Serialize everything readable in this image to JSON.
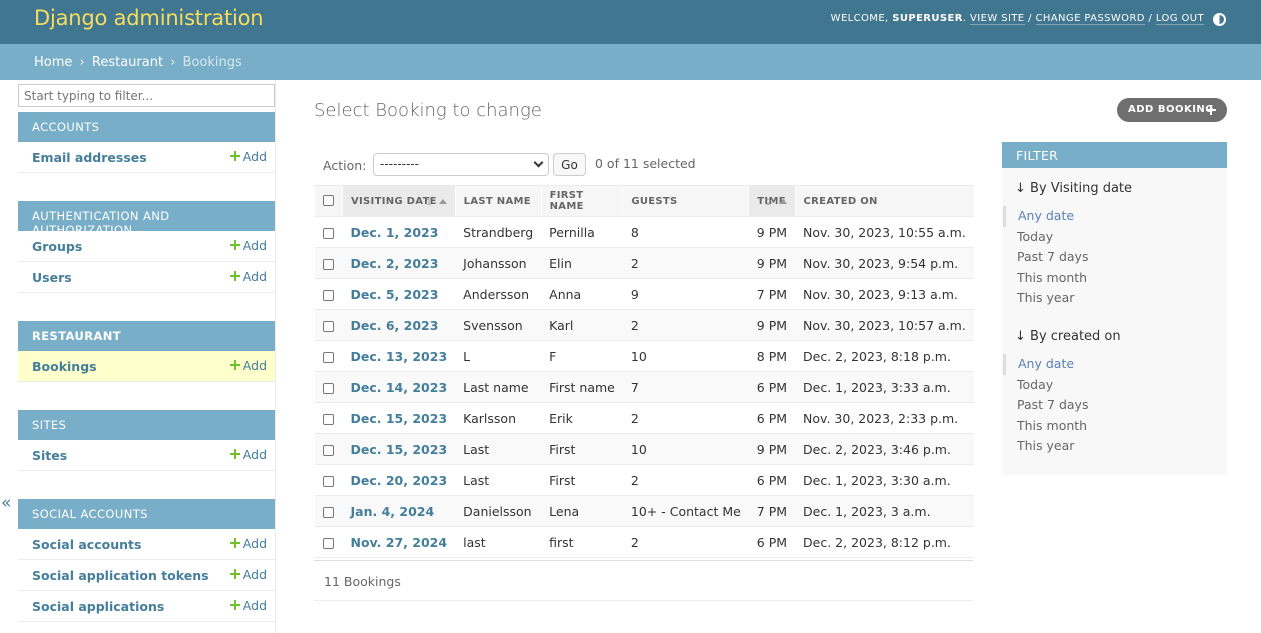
{
  "header": {
    "brand": "Django administration",
    "welcome": "WELCOME,",
    "username": "SUPERUSER",
    "view_site": "VIEW SITE",
    "change_password": "CHANGE PASSWORD",
    "log_out": "LOG OUT",
    "separator": "/"
  },
  "breadcrumbs": {
    "home": "Home",
    "app": "Restaurant",
    "current": "Bookings",
    "sep": "›"
  },
  "sidebar": {
    "filter_placeholder": "Start typing to filter...",
    "add_label": "Add",
    "collapse_glyph": "«",
    "modules": [
      {
        "caption": "Accounts",
        "rows": [
          {
            "label": "Email addresses"
          }
        ]
      },
      {
        "caption": "Authentication and Authorization",
        "rows": [
          {
            "label": "Groups"
          },
          {
            "label": "Users"
          }
        ]
      },
      {
        "caption": "Restaurant",
        "rows": [
          {
            "label": "Bookings"
          }
        ]
      },
      {
        "caption": "Sites",
        "rows": [
          {
            "label": "Sites"
          }
        ]
      },
      {
        "caption": "Social accounts",
        "rows": [
          {
            "label": "Social accounts"
          },
          {
            "label": "Social application tokens"
          },
          {
            "label": "Social applications"
          }
        ]
      }
    ]
  },
  "content": {
    "title": "Select Booking to change",
    "add_button": "ADD BOOKING",
    "action_label": "Action:",
    "action_value": "---------",
    "go_label": "Go",
    "selected_text": "0 of 11 selected",
    "paginator": "11 Bookings"
  },
  "table": {
    "columns": [
      "Visiting date",
      "Last name",
      "First name",
      "Guests",
      "Time",
      "Created on"
    ],
    "sort_numbers": {
      "visiting_date": "1",
      "time": "2"
    },
    "rows": [
      {
        "date": "Dec. 1, 2023",
        "last": "Strandberg",
        "first": "Pernilla",
        "guests": "8",
        "time": "9 PM",
        "created": "Nov. 30, 2023, 10:55 a.m."
      },
      {
        "date": "Dec. 2, 2023",
        "last": "Johansson",
        "first": "Elin",
        "guests": "2",
        "time": "9 PM",
        "created": "Nov. 30, 2023, 9:54 p.m."
      },
      {
        "date": "Dec. 5, 2023",
        "last": "Andersson",
        "first": "Anna",
        "guests": "9",
        "time": "7 PM",
        "created": "Nov. 30, 2023, 9:13 a.m."
      },
      {
        "date": "Dec. 6, 2023",
        "last": "Svensson",
        "first": "Karl",
        "guests": "2",
        "time": "9 PM",
        "created": "Nov. 30, 2023, 10:57 a.m."
      },
      {
        "date": "Dec. 13, 2023",
        "last": "L",
        "first": "F",
        "guests": "10",
        "time": "8 PM",
        "created": "Dec. 2, 2023, 8:18 p.m."
      },
      {
        "date": "Dec. 14, 2023",
        "last": "Last name",
        "first": "First name",
        "guests": "7",
        "time": "6 PM",
        "created": "Dec. 1, 2023, 3:33 a.m."
      },
      {
        "date": "Dec. 15, 2023",
        "last": "Karlsson",
        "first": "Erik",
        "guests": "2",
        "time": "6 PM",
        "created": "Nov. 30, 2023, 2:33 p.m."
      },
      {
        "date": "Dec. 15, 2023",
        "last": "Last",
        "first": "First",
        "guests": "10",
        "time": "9 PM",
        "created": "Dec. 2, 2023, 3:46 p.m."
      },
      {
        "date": "Dec. 20, 2023",
        "last": "Last",
        "first": "First",
        "guests": "2",
        "time": "6 PM",
        "created": "Dec. 1, 2023, 3:30 a.m."
      },
      {
        "date": "Jan. 4, 2024",
        "last": "Danielsson",
        "first": "Lena",
        "guests": "10+ - Contact Me",
        "time": "7 PM",
        "created": "Dec. 1, 2023, 3 a.m."
      },
      {
        "date": "Nov. 27, 2024",
        "last": "last",
        "first": "first",
        "guests": "2",
        "time": "6 PM",
        "created": "Dec. 2, 2023, 8:12 p.m."
      }
    ]
  },
  "filter": {
    "title": "FILTER",
    "groups": [
      {
        "title": "↓ By Visiting date",
        "items": [
          "Any date",
          "Today",
          "Past 7 days",
          "This month",
          "This year"
        ]
      },
      {
        "title": "↓ By created on",
        "items": [
          "Any date",
          "Today",
          "Past 7 days",
          "This month",
          "This year"
        ]
      }
    ]
  },
  "colors": {
    "header_bg": "#417690",
    "brand": "#f5dd5d",
    "breadcrumbs_bg": "#79aec8",
    "link": "#447e9b",
    "add_green": "#70bf2b",
    "current_row": "#ffffcc"
  }
}
